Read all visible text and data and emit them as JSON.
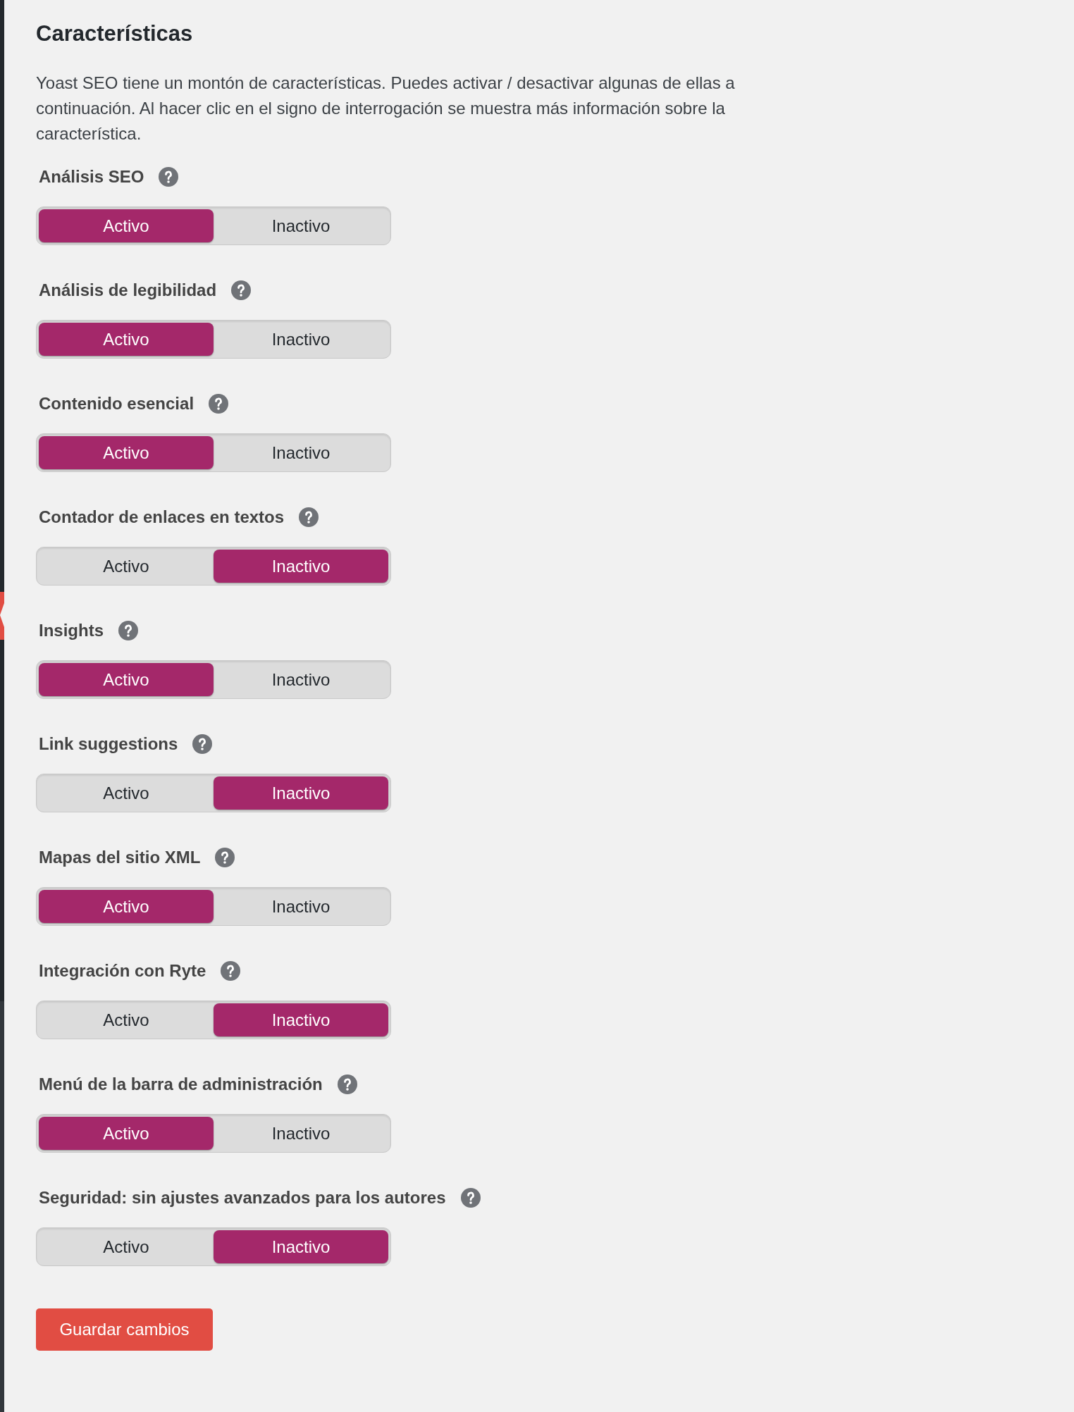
{
  "heading": "Características",
  "description": "Yoast SEO tiene un montón de características. Puedes activar / desactivar algunas de ellas a continuación. Al hacer clic en el signo de interrogación se muestra más información sobre la característica.",
  "features": [
    {
      "label": "Análisis SEO",
      "options": [
        {
          "label": "Activo",
          "selected": true
        },
        {
          "label": "Inactivo",
          "selected": false
        }
      ]
    },
    {
      "label": "Análisis de legibilidad",
      "options": [
        {
          "label": "Activo",
          "selected": true
        },
        {
          "label": "Inactivo",
          "selected": false
        }
      ]
    },
    {
      "label": "Contenido esencial",
      "options": [
        {
          "label": "Activo",
          "selected": true
        },
        {
          "label": "Inactivo",
          "selected": false
        }
      ]
    },
    {
      "label": "Contador de enlaces en textos",
      "options": [
        {
          "label": "Activo",
          "selected": false
        },
        {
          "label": "Inactivo",
          "selected": true
        }
      ]
    },
    {
      "label": "Insights",
      "options": [
        {
          "label": "Activo",
          "selected": true
        },
        {
          "label": "Inactivo",
          "selected": false
        }
      ]
    },
    {
      "label": "Link suggestions",
      "options": [
        {
          "label": "Activo",
          "selected": false
        },
        {
          "label": "Inactivo",
          "selected": true
        }
      ]
    },
    {
      "label": "Mapas del sitio XML",
      "options": [
        {
          "label": "Activo",
          "selected": true
        },
        {
          "label": "Inactivo",
          "selected": false
        }
      ]
    },
    {
      "label": "Integración con Ryte",
      "options": [
        {
          "label": "Activo",
          "selected": false
        },
        {
          "label": "Inactivo",
          "selected": true
        }
      ]
    },
    {
      "label": "Menú de la barra de administración",
      "options": [
        {
          "label": "Activo",
          "selected": true
        },
        {
          "label": "Inactivo",
          "selected": false
        }
      ]
    },
    {
      "label": "Seguridad: sin ajustes avanzados para los autores",
      "options": [
        {
          "label": "Activo",
          "selected": false
        },
        {
          "label": "Inactivo",
          "selected": true
        }
      ]
    }
  ],
  "save_button": "Guardar cambios"
}
